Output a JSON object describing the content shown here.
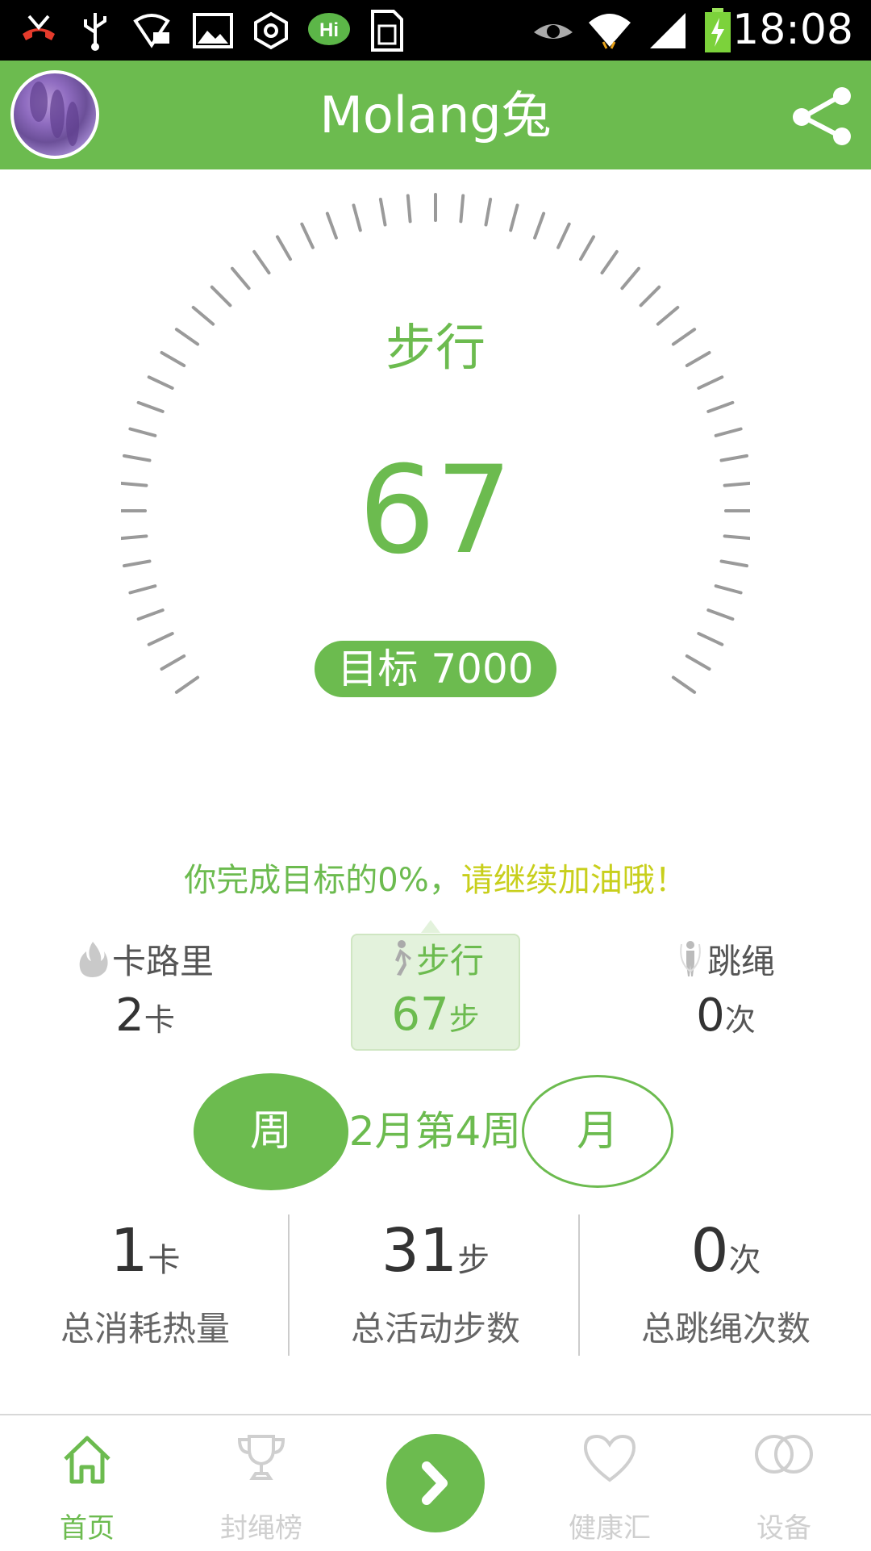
{
  "status_bar": {
    "time": "18:08",
    "icons": [
      "missed-call-icon",
      "usb-icon",
      "wifi-check-icon",
      "image-icon",
      "settings-hex-icon",
      "hi-bubble-icon",
      "sim-card-icon",
      "eye-icon",
      "wifi-icon",
      "signal-icon",
      "battery-charging-icon"
    ]
  },
  "app_bar": {
    "title": "Molang兔",
    "share_icon": "share-icon",
    "avatar": "avatar"
  },
  "dial": {
    "title": "步行",
    "value": "67",
    "goal_label": "目标 7000",
    "progress_fraction": 0.0096
  },
  "progress_message": {
    "part1": "你完成目标的0%，",
    "part2": "请继续加油哦！"
  },
  "stats": [
    {
      "label": "卡路里",
      "value": "2",
      "unit": "卡",
      "icon": "flame-icon"
    },
    {
      "label": "步行",
      "value": "67",
      "unit": "步",
      "icon": "walker-icon",
      "selected": true
    },
    {
      "label": "跳绳",
      "value": "0",
      "unit": "次",
      "icon": "jump-rope-icon"
    }
  ],
  "period": {
    "week_label": "周",
    "current_label": "2月第4周",
    "month_label": "月"
  },
  "totals": [
    {
      "value": "1",
      "unit": "卡",
      "caption": "总消耗热量"
    },
    {
      "value": "31",
      "unit": "步",
      "caption": "总活动步数"
    },
    {
      "value": "0",
      "unit": "次",
      "caption": "总跳绳次数"
    }
  ],
  "tabs": [
    {
      "label": "首页",
      "icon": "home-icon",
      "active": true
    },
    {
      "label": "封绳榜",
      "icon": "trophy-icon"
    },
    {
      "label": "",
      "icon": "chevron-right-icon"
    },
    {
      "label": "健康汇",
      "icon": "heart-icon"
    },
    {
      "label": "设备",
      "icon": "rings-icon"
    }
  ],
  "colors": {
    "brand": "#6cbb4f",
    "accent_yellow": "#c8cf1c",
    "tick_gray": "#9a9a9a"
  }
}
